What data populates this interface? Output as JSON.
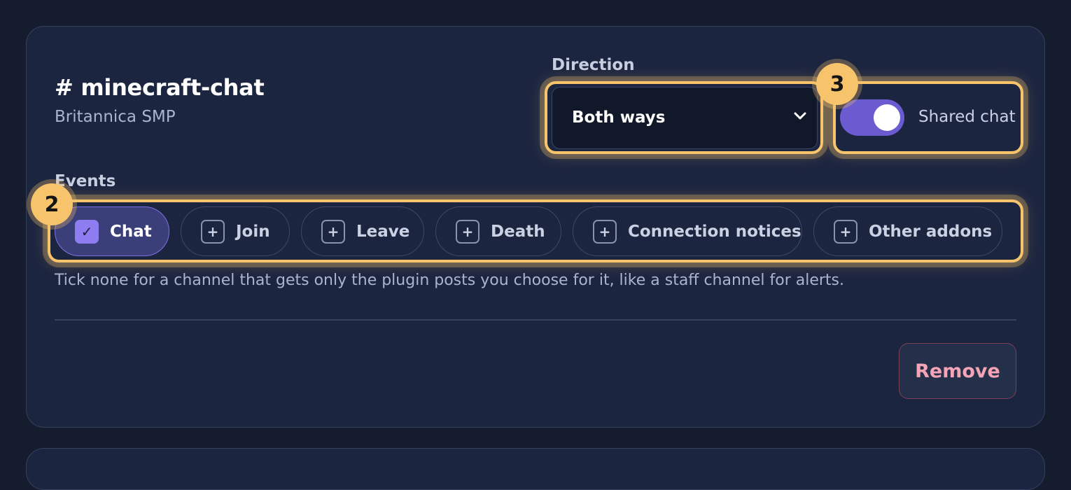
{
  "channel": {
    "title": "# minecraft-chat",
    "server": "Britannica SMP"
  },
  "direction": {
    "label": "Direction",
    "value": "Both ways",
    "icon": "chevron-down-icon"
  },
  "shared_chat": {
    "label": "Shared chat",
    "enabled": true
  },
  "events": {
    "label": "Events",
    "chips": [
      {
        "label": "Chat",
        "checked": true,
        "mark": "✓"
      },
      {
        "label": "Join",
        "checked": false,
        "mark": "+"
      },
      {
        "label": "Leave",
        "checked": false,
        "mark": "+"
      },
      {
        "label": "Death",
        "checked": false,
        "mark": "+"
      },
      {
        "label": "Connection notices",
        "checked": false,
        "mark": "+"
      },
      {
        "label": "Other addons",
        "checked": false,
        "mark": "+"
      }
    ],
    "hint": "Tick none for a channel that gets only the plugin posts you choose for it, like a staff channel for alerts."
  },
  "badges": {
    "events": "2",
    "direction": "3"
  },
  "actions": {
    "remove_label": "Remove"
  },
  "colors": {
    "accent": "#6b5bd0",
    "highlight": "#f7c46c",
    "danger": "#f3a4b7"
  }
}
